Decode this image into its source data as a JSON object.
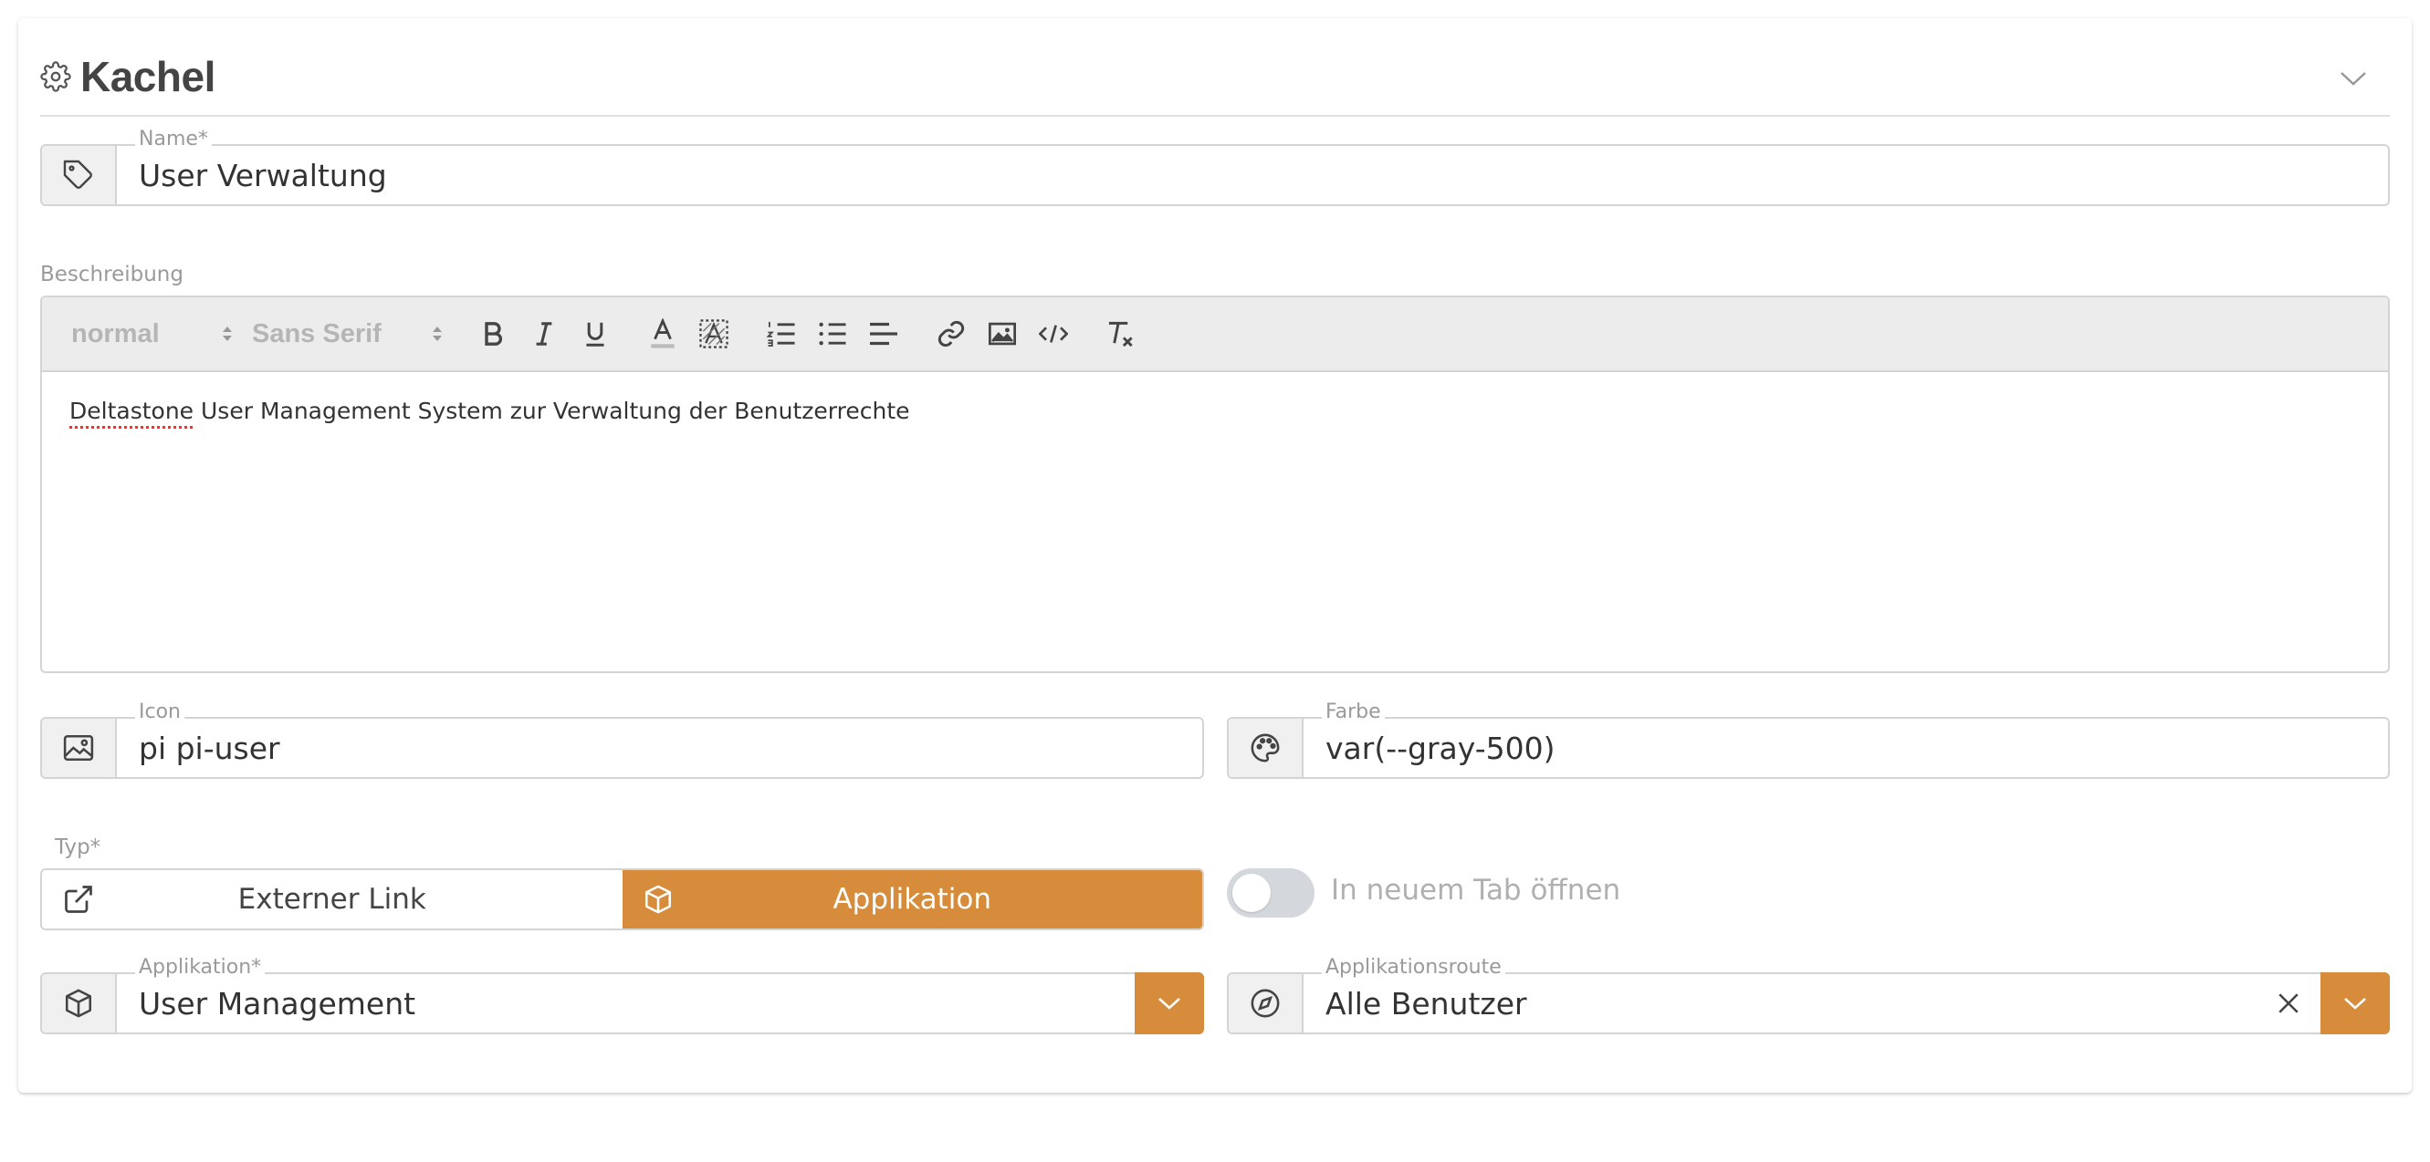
{
  "panel": {
    "title": "Kachel"
  },
  "name": {
    "label": "Name*",
    "value": "User Verwaltung"
  },
  "description": {
    "label": "Beschreibung",
    "toolbar": {
      "size": "normal",
      "font": "Sans Serif"
    },
    "content_misspelled": "Deltastone",
    "content_rest": " User Management System zur Verwaltung der Benutzerrechte"
  },
  "icon": {
    "label": "Icon",
    "value": "pi pi-user"
  },
  "color": {
    "label": "Farbe",
    "value": "var(--gray-500)"
  },
  "type": {
    "label": "Typ*",
    "options": [
      "Externer Link",
      "Applikation"
    ],
    "selected": "Applikation"
  },
  "new_tab": {
    "label": "In neuem Tab öffnen",
    "checked": false
  },
  "application": {
    "label": "Applikation*",
    "value": "User Management"
  },
  "route": {
    "label": "Applikationsroute",
    "value": "Alle Benutzer"
  },
  "colors": {
    "accent": "#d68c3a",
    "addon_bg": "#f0f0f0",
    "border": "#d4d4d4",
    "label": "#9a9a9a"
  }
}
